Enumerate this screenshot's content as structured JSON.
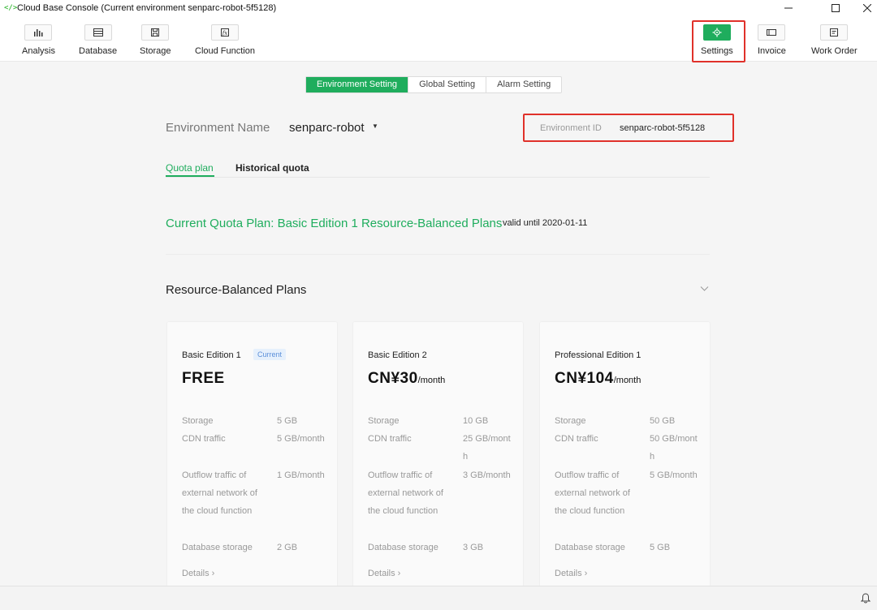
{
  "window": {
    "title": "Cloud Base Console (Current environment senparc-robot-5f5128)"
  },
  "toolbar": {
    "analysis": "Analysis",
    "database": "Database",
    "storage": "Storage",
    "cloud_function": "Cloud Function",
    "settings": "Settings",
    "invoice": "Invoice",
    "work_order": "Work Order"
  },
  "settings_tabs": [
    "Environment Setting",
    "Global Setting",
    "Alarm Setting"
  ],
  "environment": {
    "name_label": "Environment Name",
    "name": "senparc-robot",
    "id_label": "Environment ID",
    "id": "senparc-robot-5f5128"
  },
  "subtabs": {
    "quota_plan": "Quota plan",
    "historical_quota": "Historical quota"
  },
  "current_plan": {
    "text": "Current Quota Plan: Basic Edition 1 Resource-Balanced Plans",
    "valid": "valid until 2020-01-11"
  },
  "plans": {
    "title": "Resource-Balanced Plans",
    "spec_labels": [
      "Storage",
      "CDN traffic",
      "Outflow traffic of external network of the cloud function",
      "Database storage"
    ],
    "details_label": "Details",
    "cards": [
      {
        "name": "Basic Edition 1",
        "badge": "Current",
        "price": "FREE",
        "per": "",
        "storage": "5 GB",
        "cdn": "5 GB/month",
        "outflow": "1 GB/month",
        "db": "2 GB"
      },
      {
        "name": "Basic Edition 2",
        "badge": "",
        "price": "CN¥30",
        "per": "/month",
        "storage": "10 GB",
        "cdn": "25 GB/month",
        "outflow": "3 GB/month",
        "db": "3 GB"
      },
      {
        "name": "Professional Edition 1",
        "badge": "",
        "price": "CN¥104",
        "per": "/month",
        "storage": "50 GB",
        "cdn": "50 GB/month",
        "outflow": "5 GB/month",
        "db": "5 GB"
      }
    ]
  },
  "colors": {
    "accent": "#1fad5d",
    "highlight": "#e0312a"
  }
}
